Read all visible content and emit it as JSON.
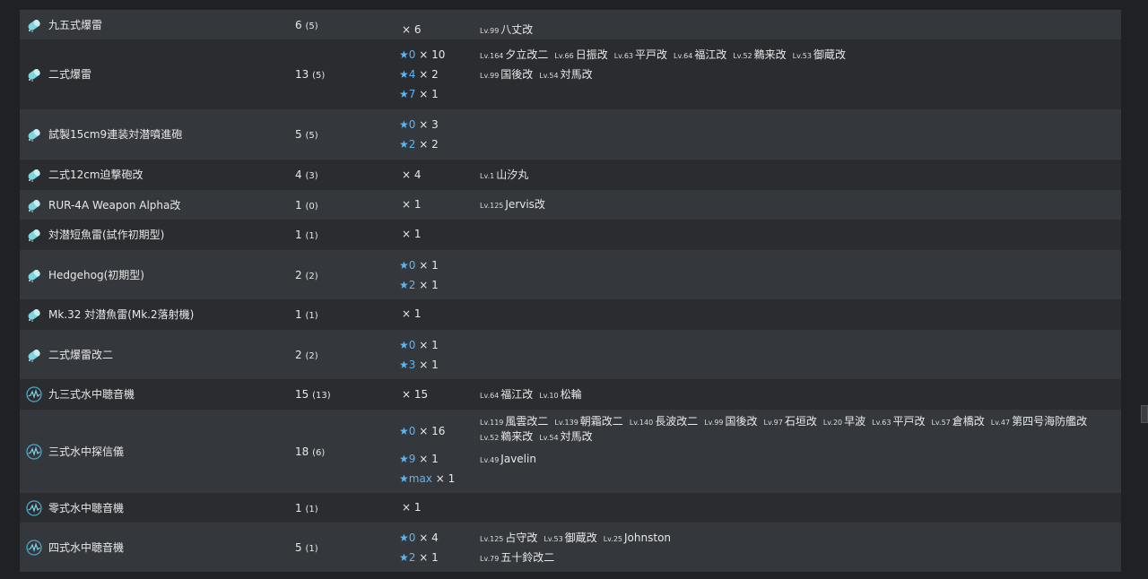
{
  "rows": [
    {
      "icon": "depth-charge-icon",
      "name": "九五式爆雷",
      "total": "6",
      "paren": "(5)",
      "improvements": [
        {
          "star": "",
          "count": "× 6",
          "ships": [
            {
              "lv": "Lv.99",
              "name": "八丈改"
            }
          ]
        }
      ]
    },
    {
      "icon": "depth-charge-icon",
      "name": "二式爆雷",
      "total": "13",
      "paren": "(5)",
      "improvements": [
        {
          "star": "★0",
          "count": "× 10",
          "ships": [
            {
              "lv": "Lv.164",
              "name": "夕立改二"
            },
            {
              "lv": "Lv.66",
              "name": "日振改"
            },
            {
              "lv": "Lv.63",
              "name": "平戸改"
            },
            {
              "lv": "Lv.64",
              "name": "福江改"
            },
            {
              "lv": "Lv.52",
              "name": "鵜来改"
            },
            {
              "lv": "Lv.53",
              "name": "御蔵改"
            }
          ]
        },
        {
          "star": "★4",
          "count": "× 2",
          "ships": [
            {
              "lv": "Lv.99",
              "name": "国後改"
            },
            {
              "lv": "Lv.54",
              "name": "対馬改"
            }
          ]
        },
        {
          "star": "★7",
          "count": "× 1",
          "ships": []
        }
      ]
    },
    {
      "icon": "depth-charge-icon",
      "name": "試製15cm9連装対潜噴進砲",
      "total": "5",
      "paren": "(5)",
      "improvements": [
        {
          "star": "★0",
          "count": "× 3",
          "ships": []
        },
        {
          "star": "★2",
          "count": "× 2",
          "ships": []
        }
      ]
    },
    {
      "icon": "depth-charge-icon",
      "name": "二式12cm迫撃砲改",
      "total": "4",
      "paren": "(3)",
      "improvements": [
        {
          "star": "",
          "count": "× 4",
          "ships": [
            {
              "lv": "Lv.1",
              "name": "山汐丸"
            }
          ]
        }
      ]
    },
    {
      "icon": "depth-charge-icon",
      "name": "RUR-4A Weapon Alpha改",
      "total": "1",
      "paren": "(0)",
      "improvements": [
        {
          "star": "",
          "count": "× 1",
          "ships": [
            {
              "lv": "Lv.125",
              "name": "Jervis改"
            }
          ]
        }
      ]
    },
    {
      "icon": "depth-charge-icon",
      "name": "対潜短魚雷(試作初期型)",
      "total": "1",
      "paren": "(1)",
      "improvements": [
        {
          "star": "",
          "count": "× 1",
          "ships": []
        }
      ]
    },
    {
      "icon": "depth-charge-icon",
      "name": "Hedgehog(初期型)",
      "total": "2",
      "paren": "(2)",
      "improvements": [
        {
          "star": "★0",
          "count": "× 1",
          "ships": []
        },
        {
          "star": "★2",
          "count": "× 1",
          "ships": []
        }
      ]
    },
    {
      "icon": "depth-charge-icon",
      "name": "Mk.32 対潜魚雷(Mk.2落射機)",
      "total": "1",
      "paren": "(1)",
      "improvements": [
        {
          "star": "",
          "count": "× 1",
          "ships": []
        }
      ]
    },
    {
      "icon": "depth-charge-icon",
      "name": "二式爆雷改二",
      "total": "2",
      "paren": "(2)",
      "improvements": [
        {
          "star": "★0",
          "count": "× 1",
          "ships": []
        },
        {
          "star": "★3",
          "count": "× 1",
          "ships": []
        }
      ]
    },
    {
      "icon": "sonar-icon",
      "name": "九三式水中聴音機",
      "total": "15",
      "paren": "(13)",
      "improvements": [
        {
          "star": "",
          "count": "× 15",
          "ships": [
            {
              "lv": "Lv.64",
              "name": "福江改"
            },
            {
              "lv": "Lv.10",
              "name": "松輪"
            }
          ]
        }
      ]
    },
    {
      "icon": "sonar-icon",
      "name": "三式水中探信儀",
      "total": "18",
      "paren": "(6)",
      "improvements": [
        {
          "star": "★0",
          "count": "× 16",
          "ships": [
            {
              "lv": "Lv.119",
              "name": "風雲改二"
            },
            {
              "lv": "Lv.139",
              "name": "朝霜改二"
            },
            {
              "lv": "Lv.140",
              "name": "長波改二"
            },
            {
              "lv": "Lv.99",
              "name": "国後改"
            },
            {
              "lv": "Lv.97",
              "name": "石垣改"
            },
            {
              "lv": "Lv.20",
              "name": "早波"
            },
            {
              "lv": "Lv.63",
              "name": "平戸改"
            },
            {
              "lv": "Lv.57",
              "name": "倉橋改"
            },
            {
              "lv": "Lv.47",
              "name": "第四号海防艦改"
            }
          ],
          "ships2": [
            {
              "lv": "Lv.52",
              "name": "鵜来改"
            },
            {
              "lv": "Lv.54",
              "name": "対馬改"
            }
          ]
        },
        {
          "star": "★9",
          "count": "× 1",
          "ships": [
            {
              "lv": "Lv.49",
              "name": "Javelin"
            }
          ]
        },
        {
          "star": "★max",
          "count": "× 1",
          "ships": []
        }
      ]
    },
    {
      "icon": "sonar-icon",
      "name": "零式水中聴音機",
      "total": "1",
      "paren": "(1)",
      "improvements": [
        {
          "star": "",
          "count": "× 1",
          "ships": []
        }
      ]
    },
    {
      "icon": "sonar-icon",
      "name": "四式水中聴音機",
      "total": "5",
      "paren": "(1)",
      "improvements": [
        {
          "star": "★0",
          "count": "× 4",
          "ships": [
            {
              "lv": "Lv.125",
              "name": "占守改"
            },
            {
              "lv": "Lv.53",
              "name": "御蔵改"
            },
            {
              "lv": "Lv.25",
              "name": "Johnston"
            }
          ]
        },
        {
          "star": "★2",
          "count": "× 1",
          "ships": [
            {
              "lv": "Lv.79",
              "name": "五十鈴改二"
            }
          ]
        }
      ]
    }
  ]
}
